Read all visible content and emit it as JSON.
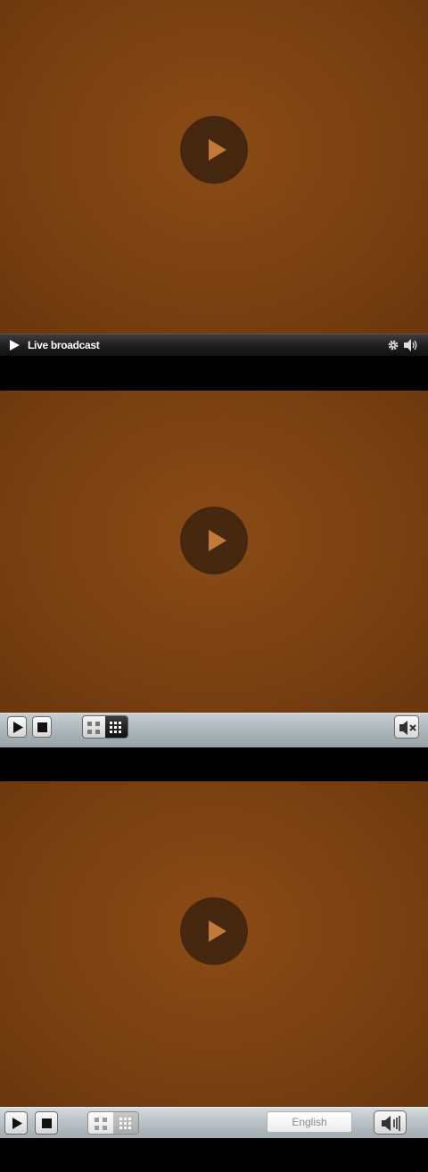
{
  "players": [
    {
      "controlbar": {
        "title": "Live broadcast",
        "icons": [
          "play-icon",
          "gear-icon",
          "volume-icon"
        ]
      },
      "overlay_icon": "play-icon"
    },
    {
      "controlbar": {
        "icons": [
          "play-icon",
          "stop-icon",
          "grid-2x2-icon",
          "grid-3x3-icon",
          "mute-icon"
        ]
      },
      "overlay_icon": "play-icon"
    },
    {
      "controlbar": {
        "language": "English",
        "icons": [
          "play-icon",
          "stop-icon",
          "grid-2x2-icon",
          "grid-3x3-icon",
          "volume-icon"
        ]
      },
      "overlay_icon": "play-icon"
    }
  ],
  "colors": {
    "video_bg": "#7e4313",
    "overlay_button": "#3a220e",
    "overlay_triangle": "#c27a3a",
    "bar_dark": "#1e1e1e",
    "bar_light": "#a9b3b8"
  }
}
